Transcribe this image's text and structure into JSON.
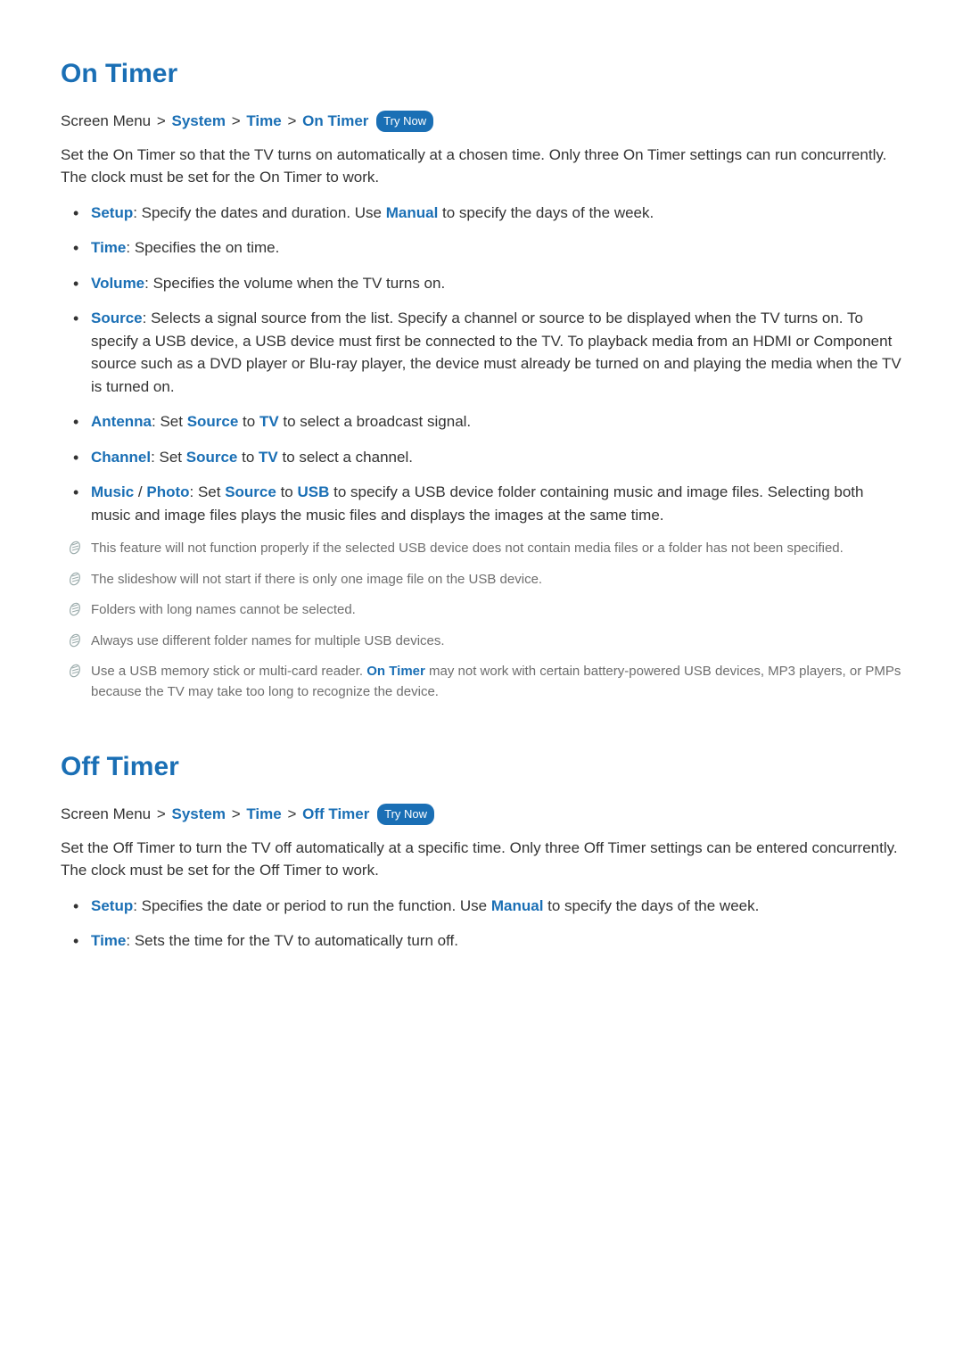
{
  "sections": [
    {
      "title": "On Timer",
      "breadcrumb": {
        "prefix": "Screen Menu",
        "crumbs": [
          "System",
          "Time",
          "On Timer"
        ],
        "tryNow": "Try Now"
      },
      "intro": "Set the On Timer so that the TV turns on automatically at a chosen time. Only three On Timer settings can run concurrently. The clock must be set for the On Timer to work.",
      "bullets": [
        {
          "parts": [
            {
              "t": "kw",
              "v": "Setup"
            },
            {
              "t": "txt",
              "v": ": Specify the dates and duration. Use "
            },
            {
              "t": "kw",
              "v": "Manual"
            },
            {
              "t": "txt",
              "v": " to specify the days of the week."
            }
          ]
        },
        {
          "parts": [
            {
              "t": "kw",
              "v": "Time"
            },
            {
              "t": "txt",
              "v": ": Specifies the on time."
            }
          ]
        },
        {
          "parts": [
            {
              "t": "kw",
              "v": "Volume"
            },
            {
              "t": "txt",
              "v": ": Specifies the volume when the TV turns on."
            }
          ]
        },
        {
          "parts": [
            {
              "t": "kw",
              "v": "Source"
            },
            {
              "t": "txt",
              "v": ": Selects a signal source from the list. Specify a channel or source to be displayed when the TV turns on. To specify a USB device, a USB device must first be connected to the TV. To playback media from an HDMI or Component source such as a DVD player or Blu-ray player, the device must already be turned on and playing the media when the TV is turned on."
            }
          ]
        },
        {
          "parts": [
            {
              "t": "kw",
              "v": "Antenna"
            },
            {
              "t": "txt",
              "v": ": Set "
            },
            {
              "t": "kw",
              "v": "Source"
            },
            {
              "t": "txt",
              "v": " to "
            },
            {
              "t": "kw",
              "v": "TV"
            },
            {
              "t": "txt",
              "v": " to select a broadcast signal."
            }
          ]
        },
        {
          "parts": [
            {
              "t": "kw",
              "v": "Channel"
            },
            {
              "t": "txt",
              "v": ": Set "
            },
            {
              "t": "kw",
              "v": "Source"
            },
            {
              "t": "txt",
              "v": " to "
            },
            {
              "t": "kw",
              "v": "TV"
            },
            {
              "t": "txt",
              "v": " to select a channel."
            }
          ]
        },
        {
          "parts": [
            {
              "t": "kw",
              "v": "Music"
            },
            {
              "t": "txt",
              "v": " / "
            },
            {
              "t": "kw",
              "v": "Photo"
            },
            {
              "t": "txt",
              "v": ": Set "
            },
            {
              "t": "kw",
              "v": "Source"
            },
            {
              "t": "txt",
              "v": " to "
            },
            {
              "t": "kw",
              "v": "USB"
            },
            {
              "t": "txt",
              "v": " to specify a USB device folder containing music and image files. Selecting both music and image files plays the music files and displays the images at the same time."
            }
          ]
        }
      ],
      "notes": [
        {
          "parts": [
            {
              "t": "txt",
              "v": "This feature will not function properly if the selected USB device does not contain media files or a folder has not been specified."
            }
          ]
        },
        {
          "parts": [
            {
              "t": "txt",
              "v": "The slideshow will not start if there is only one image file on the USB device."
            }
          ]
        },
        {
          "parts": [
            {
              "t": "txt",
              "v": "Folders with long names cannot be selected."
            }
          ]
        },
        {
          "parts": [
            {
              "t": "txt",
              "v": "Always use different folder names for multiple USB devices."
            }
          ]
        },
        {
          "parts": [
            {
              "t": "txt",
              "v": "Use a USB memory stick or multi-card reader. "
            },
            {
              "t": "kw",
              "v": "On Timer"
            },
            {
              "t": "txt",
              "v": " may not work with certain battery-powered USB devices, MP3 players, or PMPs because the TV may take too long to recognize the device."
            }
          ]
        }
      ]
    },
    {
      "title": "Off Timer",
      "breadcrumb": {
        "prefix": "Screen Menu",
        "crumbs": [
          "System",
          "Time",
          "Off Timer"
        ],
        "tryNow": "Try Now"
      },
      "intro": "Set the Off Timer to turn the TV off automatically at a specific time. Only three Off Timer settings can be entered concurrently. The clock must be set for the Off Timer to work.",
      "bullets": [
        {
          "parts": [
            {
              "t": "kw",
              "v": "Setup"
            },
            {
              "t": "txt",
              "v": ": Specifies the date or period to run the function. Use "
            },
            {
              "t": "kw",
              "v": "Manual"
            },
            {
              "t": "txt",
              "v": " to specify the days of the week."
            }
          ]
        },
        {
          "parts": [
            {
              "t": "kw",
              "v": "Time"
            },
            {
              "t": "txt",
              "v": ": Sets the time for the TV to automatically turn off."
            }
          ]
        }
      ],
      "notes": []
    }
  ]
}
